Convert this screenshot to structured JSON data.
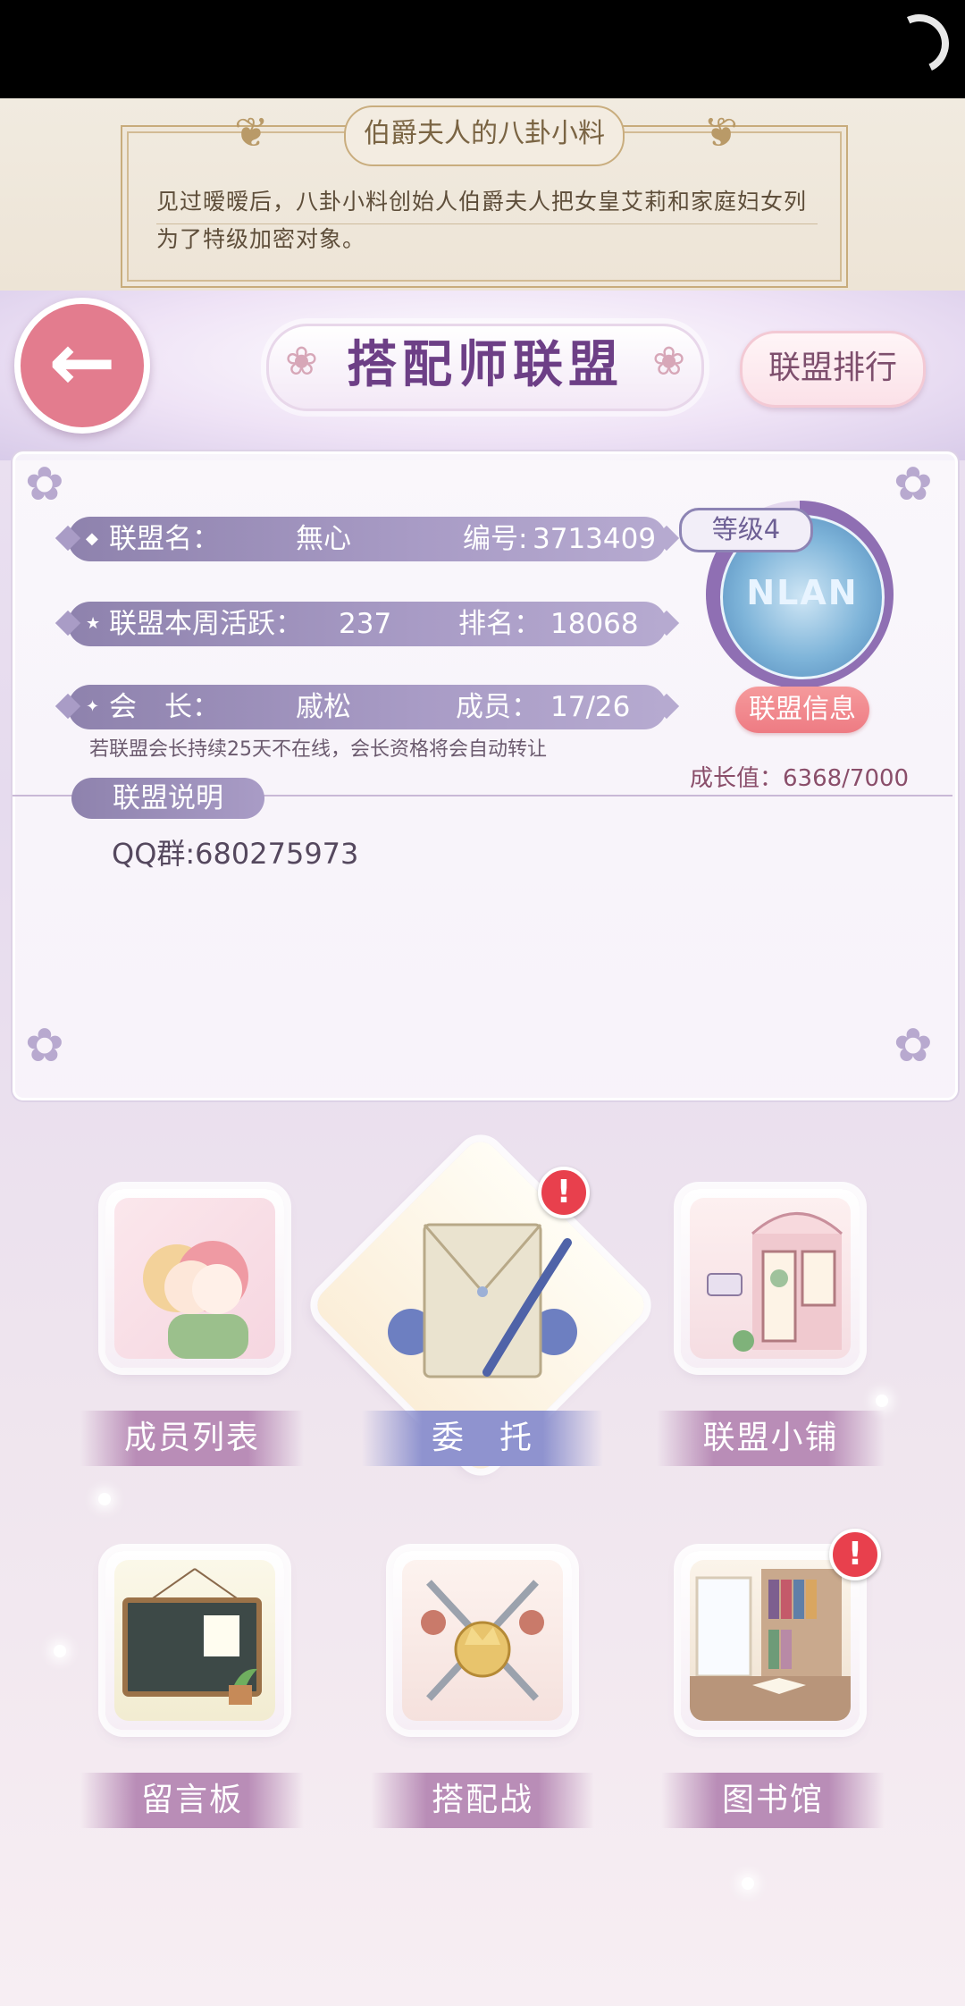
{
  "notice": {
    "title": "伯爵夫人的八卦小料",
    "text": "见过暧暧后，八卦小料创始人伯爵夫人把女皇艾莉和家庭妇女列为了特级加密对象。"
  },
  "header": {
    "back_label": "←",
    "title": "搭配师联盟",
    "ranking_button": "联盟排行"
  },
  "alliance": {
    "name_label": "联盟名：",
    "name": "無心",
    "id_label": "编号:",
    "id": "3713409",
    "activity_label": "联盟本周活跃：",
    "activity": "237",
    "rank_label": "排名：",
    "rank": "18068",
    "leader_label": "会　长：",
    "leader": "戚松",
    "members_label": "成员：",
    "members": "17/26",
    "leader_note": "若联盟会长持续25天不在线，会长资格将会自动转让",
    "level_tag": "等级4",
    "emblem_text": "NLAN",
    "info_button": "联盟信息",
    "growth": "成长值：6368/7000",
    "growth_progress": 0.9097,
    "description_label": "联盟说明",
    "description": "QQ群:680275973"
  },
  "features": [
    {
      "label": "成员列表",
      "icon": "members-icon",
      "alert": false
    },
    {
      "label": "委　托",
      "icon": "commission-letter-icon",
      "alert": true
    },
    {
      "label": "联盟小铺",
      "icon": "shop-icon",
      "alert": false
    },
    {
      "label": "留言板",
      "icon": "message-board-icon",
      "alert": false
    },
    {
      "label": "搭配战",
      "icon": "battle-swords-icon",
      "alert": false
    },
    {
      "label": "图书馆",
      "icon": "library-icon",
      "alert": true
    }
  ],
  "alert_mark": "!",
  "colors": {
    "accent_purple": "#8e82ad",
    "alert_red": "#e8404d",
    "back_button": "#e37c8e"
  }
}
